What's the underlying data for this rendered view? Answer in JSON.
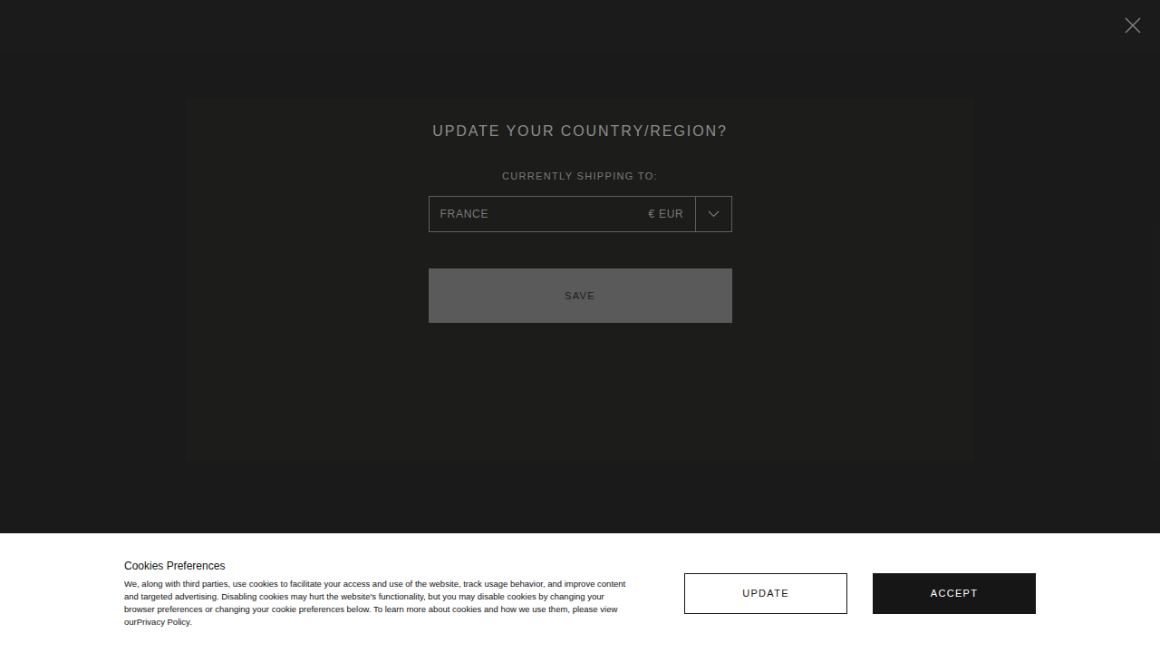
{
  "modal": {
    "title": "UPDATE YOUR COUNTRY/REGION?",
    "label": "CURRENTLY SHIPPING TO:",
    "country": "FRANCE",
    "currency": "€ EUR",
    "save_button": "SAVE"
  },
  "cookie_banner": {
    "title": "Cookies Preferences",
    "text": "We, along with third parties, use cookies to facilitate your access and use of the website, track usage behavior, and improve content and targeted advertising. Disabling cookies may hurt the website's functionality, but you may disable cookies by changing your browser preferences or changing your cookie preferences below. To learn more about cookies and how we use them, please view our",
    "link": "Privacy Policy",
    "suffix": ".",
    "buttons": [
      {
        "label": "UPDATE",
        "kind": "outline"
      },
      {
        "label": "ACCEPT",
        "kind": "solid"
      }
    ]
  }
}
